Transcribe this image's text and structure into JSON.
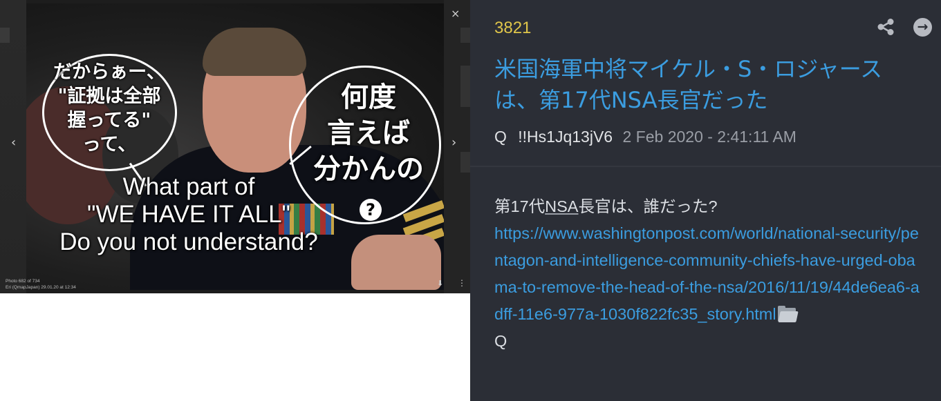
{
  "viewer": {
    "photo_counter": "Photo 682 of 734",
    "photo_credit": "Eri (QmapJapan)   29.01.20 at 12:34",
    "speech_left": [
      "だからぁー、",
      "\"証拠は全部",
      "握ってる\"",
      "って、"
    ],
    "speech_right": [
      "何度",
      "言えば",
      "分かんの"
    ],
    "question_mark": "?",
    "caption_en": [
      "What part of",
      "\"WE HAVE IT ALL\"",
      "Do you not understand?"
    ],
    "prev_glyph": "‹",
    "next_glyph": "›",
    "close_glyph": "×",
    "download_glyph": "⬇",
    "more_glyph": "⋮"
  },
  "post": {
    "number": "3821",
    "title": "米国海軍中将マイケル・S・ロジャースは、第17代NSA長官だった",
    "author": "Q",
    "tripcode": "!!Hs1Jq13jV6",
    "date": "2 Feb 2020 - 2:41:11 AM",
    "question_prefix": "第17代",
    "question_abbr": "NSA",
    "question_suffix": "長官は、誰だった?",
    "link": "https://www.washingtonpost.com/world/national-security/pentagon-and-intelligence-community-chiefs-have-urged-obama-to-remove-the-head-of-the-nsa/2016/11/19/44de6ea6-adff-11e6-977a-1030f822fc35_story.html",
    "signature": "Q",
    "next_glyph": "→"
  },
  "icons": {
    "share": "share-icon",
    "next": "arrow-right-circle-icon",
    "folder": "folder-icon"
  },
  "colors": {
    "panel_bg": "#2b2e36",
    "post_number": "#e0c64a",
    "link_blue": "#3b9de0",
    "text": "#dcdfe4"
  }
}
